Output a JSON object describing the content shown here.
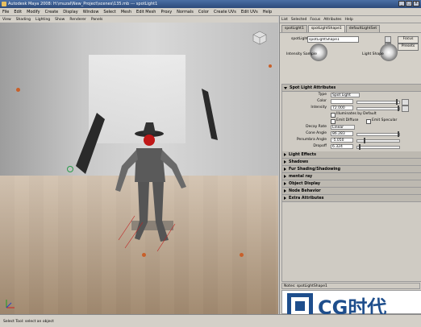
{
  "window": {
    "title": "Autodesk Maya 2008: H:\\muzal\\New_Project\\scenes\\135.mb  ---  spotLight1",
    "minimize": "_",
    "maximize": "□",
    "close": "×"
  },
  "menubar": [
    "File",
    "Edit",
    "Modify",
    "Create",
    "Display",
    "Window",
    "Select",
    "Mesh",
    "Edit Mesh",
    "Proxy",
    "Normals",
    "Color",
    "Create UVs",
    "Edit UVs",
    "Help"
  ],
  "viewport_menu": [
    "View",
    "Shading",
    "Lighting",
    "Show",
    "Renderer",
    "Panels"
  ],
  "attr_editor": {
    "menu": [
      "List",
      "Selected",
      "Focus",
      "Attributes",
      "Help"
    ],
    "tabs": [
      "spotLight1",
      "spotLightShape1",
      "defaultLightSet"
    ],
    "active_tab": 1,
    "node_label": "spotLight:",
    "node_value": "spotLightShape1",
    "focus_label": "Focus",
    "presets_label": "Presets",
    "intensity_sample_label": "Intensity Sample",
    "light_shape_label": "Light Shape",
    "section_title": "Spot Light Attributes",
    "type_label": "Type",
    "type_value": "Spot Light",
    "color_label": "Color",
    "intensity_label": "Intensity",
    "intensity_value": "72.000",
    "illuminates_label": "Illuminates by Default",
    "emit_diffuse_label": "Emit Diffuse",
    "emit_specular_label": "Emit Specular",
    "decay_label": "Decay Rate",
    "decay_value": "Linear",
    "cone_label": "Cone Angle",
    "cone_value": "86.283",
    "penumbra_label": "Penumbra Angle",
    "penumbra_value": "-5.050",
    "dropoff_label": "Dropoff",
    "dropoff_value": "6.324",
    "sections": [
      "Light Effects",
      "Shadows",
      "Fur Shading/Shadowing",
      "mental ray",
      "Object Display",
      "Node Behavior",
      "Extra Attributes"
    ],
    "notes_label": "Notes:  spotLightShape1"
  },
  "status_text": "Select Tool: select an object",
  "logo_text": "CG时代",
  "colors": {
    "title_bar": "#2c4a7a",
    "panel": "#d4d0c8",
    "accent": "#c8602a"
  }
}
